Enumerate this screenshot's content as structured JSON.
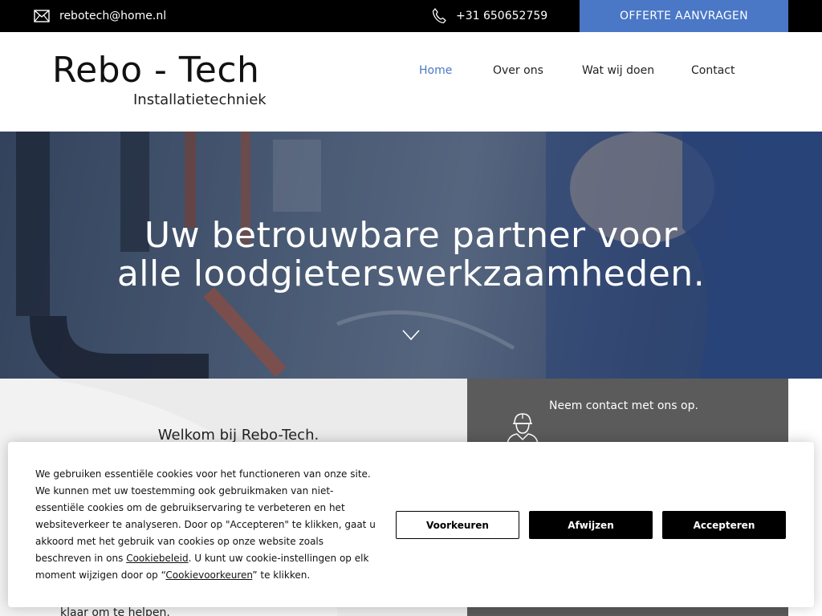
{
  "topbar": {
    "email": "rebotech@home.nl",
    "phone": "+31 650652759",
    "cta_label": "OFFERTE AANVRAGEN",
    "email_icon": "mail-icon",
    "phone_icon": "phone-icon"
  },
  "header": {
    "logo_title": "Rebo - Tech",
    "logo_subtitle": "Installatietechniek",
    "nav": [
      {
        "label": "Home",
        "active": true
      },
      {
        "label": "Over ons",
        "active": false
      },
      {
        "label": "Wat wij doen",
        "active": false
      },
      {
        "label": "Contact",
        "active": false
      }
    ]
  },
  "hero": {
    "headline_line1": "Uw betrouwbare partner voor",
    "headline_line2": "alle loodgieterswerkzaamheden.",
    "scroll_icon": "chevron-down-icon"
  },
  "welcome": {
    "title": "Welkom bij Rebo-Tech.",
    "tail_text": "klaar om te helpen."
  },
  "contact_panel": {
    "text": "Neem contact met ons op.",
    "icon": "worker-icon"
  },
  "cookie": {
    "text_part1": "We gebruiken essentiële cookies voor het functioneren van onze site. We kunnen met uw toestemming ook gebruikmaken van niet-essentiële cookies om de gebruikservaring te verbeteren en het websiteverkeer te analyseren. Door op \"Accepteren\" te klikken, gaat u akkoord met het gebruik van cookies op onze website zoals beschreven in ons ",
    "policy_link": "Cookiebeleid",
    "text_part2": ". U kunt uw cookie-instellingen op elk moment wijzigen door op “",
    "prefs_link": "Cookievoorkeuren",
    "text_part3": "” te klikken.",
    "btn_preferences": "Voorkeuren",
    "btn_reject": "Afwijzen",
    "btn_accept": "Accepteren"
  },
  "colors": {
    "accent": "#4a77c6",
    "topbar_bg": "#000000",
    "panel_bg": "#5b5b5b"
  }
}
